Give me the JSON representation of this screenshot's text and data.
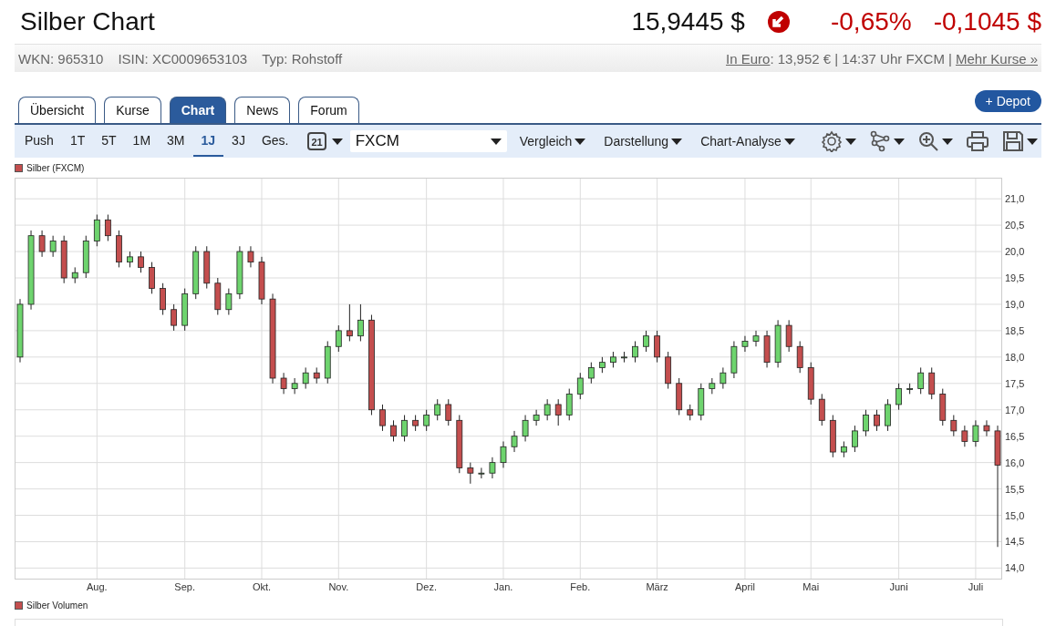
{
  "header": {
    "title": "Silber Chart",
    "price": "15,9445 $",
    "change_pct": "-0,65%",
    "change_abs": "-0,1045 $"
  },
  "info_bar": {
    "items": [
      "WKN: 965310",
      "ISIN: XC0009653103",
      "Typ: Rohstoff"
    ],
    "euro_link": "In Euro",
    "euro_text": ": 13,952 € | 14:37 Uhr FXCM |",
    "more_link": "Mehr Kurse »"
  },
  "tabs": [
    {
      "label": "Übersicht",
      "selected": false
    },
    {
      "label": "Kurse",
      "selected": false
    },
    {
      "label": "Chart",
      "selected": true
    },
    {
      "label": "News",
      "selected": false
    },
    {
      "label": "Forum",
      "selected": false
    }
  ],
  "depot_button": "+ Depot",
  "toolbar": {
    "periods": [
      {
        "label": "Push",
        "selected": false
      },
      {
        "label": "1T",
        "selected": false
      },
      {
        "label": "5T",
        "selected": false
      },
      {
        "label": "1M",
        "selected": false
      },
      {
        "label": "3M",
        "selected": false
      },
      {
        "label": "1J",
        "selected": true
      },
      {
        "label": "3J",
        "selected": false
      },
      {
        "label": "Ges.",
        "selected": false
      }
    ],
    "calendar_day": "21",
    "exchange": "FXCM",
    "menus": [
      "Vergleich",
      "Darstellung",
      "Chart-Analyse"
    ]
  },
  "price_chart": {
    "chart_data": {
      "type": "candlestick",
      "title": "Silber (FXCM)",
      "grid": true,
      "ylim": [
        13.8,
        21.4
      ],
      "yticks": [
        {
          "value": 21,
          "label": "21,0"
        },
        {
          "value": 20.5,
          "label": "20,5"
        },
        {
          "value": 20,
          "label": "20,0"
        },
        {
          "value": 19.5,
          "label": "19,5"
        },
        {
          "value": 19,
          "label": "19,0"
        },
        {
          "value": 18.5,
          "label": "18,5"
        },
        {
          "value": 18,
          "label": "18,0"
        },
        {
          "value": 17.5,
          "label": "17,5"
        },
        {
          "value": 17,
          "label": "17,0"
        },
        {
          "value": 16.5,
          "label": "16,5"
        },
        {
          "value": 16,
          "label": "16,0"
        },
        {
          "value": 15.5,
          "label": "15,5"
        },
        {
          "value": 15,
          "label": "15,0"
        },
        {
          "value": 14.5,
          "label": "14,5"
        },
        {
          "value": 14,
          "label": "14,0"
        }
      ],
      "categories": [
        null,
        null,
        null,
        null,
        null,
        null,
        null,
        "Aug.",
        null,
        null,
        null,
        null,
        null,
        null,
        null,
        "Sep.",
        null,
        null,
        null,
        null,
        null,
        null,
        "Okt.",
        null,
        null,
        null,
        null,
        null,
        null,
        "Nov.",
        null,
        null,
        null,
        null,
        null,
        null,
        null,
        "Dez.",
        null,
        null,
        null,
        null,
        null,
        null,
        "Jan.",
        null,
        null,
        null,
        null,
        null,
        null,
        "Feb.",
        null,
        null,
        null,
        null,
        null,
        null,
        "März",
        null,
        null,
        null,
        null,
        null,
        null,
        null,
        "April",
        null,
        null,
        null,
        null,
        null,
        "Mai",
        null,
        null,
        null,
        null,
        null,
        null,
        null,
        "Juni",
        null,
        null,
        null,
        null,
        null,
        null,
        "Juli",
        null,
        null
      ],
      "ohlc": [
        [
          18.0,
          19.1,
          17.9,
          19.0
        ],
        [
          19.0,
          20.4,
          18.9,
          20.3
        ],
        [
          20.3,
          20.4,
          19.9,
          20.0
        ],
        [
          20.0,
          20.3,
          19.9,
          20.2
        ],
        [
          20.2,
          20.3,
          19.4,
          19.5
        ],
        [
          19.5,
          19.7,
          19.4,
          19.6
        ],
        [
          19.6,
          20.3,
          19.5,
          20.2
        ],
        [
          20.2,
          20.7,
          20.1,
          20.6
        ],
        [
          20.6,
          20.7,
          20.2,
          20.3
        ],
        [
          20.3,
          20.4,
          19.7,
          19.8
        ],
        [
          19.8,
          20.0,
          19.7,
          19.9
        ],
        [
          19.9,
          20.0,
          19.6,
          19.7
        ],
        [
          19.7,
          19.8,
          19.2,
          19.3
        ],
        [
          19.3,
          19.4,
          18.8,
          18.9
        ],
        [
          18.9,
          19.0,
          18.5,
          18.6
        ],
        [
          18.6,
          19.3,
          18.5,
          19.2
        ],
        [
          19.2,
          20.1,
          19.1,
          20.0
        ],
        [
          20.0,
          20.1,
          19.3,
          19.4
        ],
        [
          19.4,
          19.5,
          18.8,
          18.9
        ],
        [
          18.9,
          19.3,
          18.8,
          19.2
        ],
        [
          19.2,
          20.1,
          19.1,
          20.0
        ],
        [
          20.0,
          20.1,
          19.7,
          19.8
        ],
        [
          19.8,
          19.9,
          19.0,
          19.1
        ],
        [
          19.1,
          19.2,
          17.5,
          17.6
        ],
        [
          17.6,
          17.7,
          17.3,
          17.4
        ],
        [
          17.4,
          17.6,
          17.3,
          17.5
        ],
        [
          17.5,
          17.8,
          17.4,
          17.7
        ],
        [
          17.7,
          17.8,
          17.5,
          17.6
        ],
        [
          17.6,
          18.3,
          17.5,
          18.2
        ],
        [
          18.2,
          18.6,
          18.1,
          18.5
        ],
        [
          18.5,
          19.0,
          18.3,
          18.4
        ],
        [
          18.4,
          19.0,
          18.3,
          18.7
        ],
        [
          18.7,
          18.8,
          16.9,
          17.0
        ],
        [
          17.0,
          17.1,
          16.6,
          16.7
        ],
        [
          16.7,
          16.8,
          16.4,
          16.5
        ],
        [
          16.5,
          16.9,
          16.4,
          16.8
        ],
        [
          16.8,
          16.9,
          16.6,
          16.7
        ],
        [
          16.7,
          17.0,
          16.6,
          16.9
        ],
        [
          16.9,
          17.2,
          16.8,
          17.1
        ],
        [
          17.1,
          17.2,
          16.7,
          16.8
        ],
        [
          16.8,
          16.9,
          15.8,
          15.9
        ],
        [
          15.9,
          16.0,
          15.6,
          15.8
        ],
        [
          15.8,
          15.9,
          15.7,
          15.8
        ],
        [
          15.8,
          16.1,
          15.7,
          16.0
        ],
        [
          16.0,
          16.4,
          15.9,
          16.3
        ],
        [
          16.3,
          16.6,
          16.2,
          16.5
        ],
        [
          16.5,
          16.9,
          16.4,
          16.8
        ],
        [
          16.8,
          17.0,
          16.7,
          16.9
        ],
        [
          16.9,
          17.2,
          16.8,
          17.1
        ],
        [
          17.1,
          17.2,
          16.7,
          16.9
        ],
        [
          16.9,
          17.4,
          16.8,
          17.3
        ],
        [
          17.3,
          17.7,
          17.2,
          17.6
        ],
        [
          17.6,
          17.9,
          17.5,
          17.8
        ],
        [
          17.8,
          18.0,
          17.7,
          17.9
        ],
        [
          17.9,
          18.1,
          17.8,
          18.0
        ],
        [
          18.0,
          18.1,
          17.9,
          18.0
        ],
        [
          18.0,
          18.3,
          17.9,
          18.2
        ],
        [
          18.2,
          18.5,
          18.1,
          18.4
        ],
        [
          18.4,
          18.5,
          17.9,
          18.0
        ],
        [
          18.0,
          18.1,
          17.4,
          17.5
        ],
        [
          17.5,
          17.6,
          16.9,
          17.0
        ],
        [
          17.0,
          17.1,
          16.8,
          16.9
        ],
        [
          16.9,
          17.5,
          16.8,
          17.4
        ],
        [
          17.4,
          17.6,
          17.3,
          17.5
        ],
        [
          17.5,
          17.8,
          17.4,
          17.7
        ],
        [
          17.7,
          18.3,
          17.6,
          18.2
        ],
        [
          18.2,
          18.4,
          18.1,
          18.3
        ],
        [
          18.3,
          18.5,
          18.2,
          18.4
        ],
        [
          18.4,
          18.5,
          17.8,
          17.9
        ],
        [
          17.9,
          18.7,
          17.8,
          18.6
        ],
        [
          18.6,
          18.7,
          18.1,
          18.2
        ],
        [
          18.2,
          18.3,
          17.7,
          17.8
        ],
        [
          17.8,
          17.9,
          17.1,
          17.2
        ],
        [
          17.2,
          17.3,
          16.7,
          16.8
        ],
        [
          16.8,
          16.9,
          16.1,
          16.2
        ],
        [
          16.2,
          16.4,
          16.1,
          16.3
        ],
        [
          16.3,
          16.7,
          16.2,
          16.6
        ],
        [
          16.6,
          17.0,
          16.5,
          16.9
        ],
        [
          16.9,
          17.0,
          16.6,
          16.7
        ],
        [
          16.7,
          17.2,
          16.6,
          17.1
        ],
        [
          17.1,
          17.5,
          17.0,
          17.4
        ],
        [
          17.4,
          17.5,
          17.3,
          17.4
        ],
        [
          17.4,
          17.8,
          17.3,
          17.7
        ],
        [
          17.7,
          17.8,
          17.2,
          17.3
        ],
        [
          17.3,
          17.4,
          16.7,
          16.8
        ],
        [
          16.8,
          16.9,
          16.5,
          16.6
        ],
        [
          16.6,
          16.7,
          16.3,
          16.4
        ],
        [
          16.4,
          16.8,
          16.3,
          16.7
        ],
        [
          16.7,
          16.8,
          16.5,
          16.6
        ],
        [
          16.6,
          16.7,
          14.4,
          15.95
        ]
      ]
    }
  },
  "volume_chart": {
    "legend": "Silber Volumen"
  }
}
